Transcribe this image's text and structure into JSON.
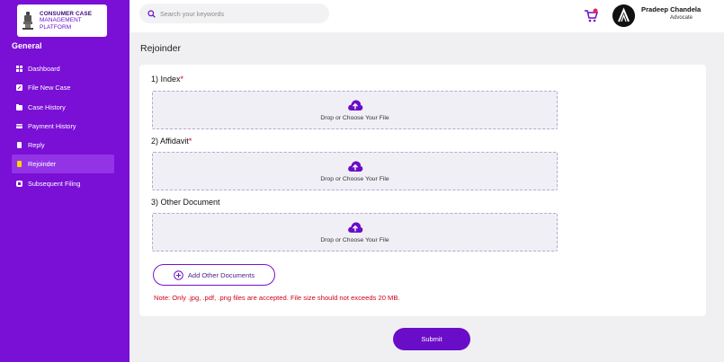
{
  "app": {
    "logo_line1": "CONSUMER CASE",
    "logo_line2": "MANAGEMENT",
    "logo_line3": "PLATFORM"
  },
  "sidebar": {
    "section": "General",
    "items": [
      {
        "label": "Dashboard",
        "icon": "grid-icon",
        "active": false
      },
      {
        "label": "File New Case",
        "icon": "edit-icon",
        "active": false
      },
      {
        "label": "Case History",
        "icon": "folder-icon",
        "active": false
      },
      {
        "label": "Payment History",
        "icon": "card-icon",
        "active": false
      },
      {
        "label": "Reply",
        "icon": "document-icon",
        "active": false
      },
      {
        "label": "Rejoinder",
        "icon": "document-icon",
        "active": true
      },
      {
        "label": "Subsequent Filing",
        "icon": "stack-icon",
        "active": false
      }
    ]
  },
  "header": {
    "search_placeholder": "Search your keywords",
    "user_name": "Pradeep Chandela",
    "user_role": "Advocate"
  },
  "page": {
    "title": "Rejoinder"
  },
  "fields": [
    {
      "label": "1) Index",
      "required": "*",
      "drop_text": "Drop or Choose Your File"
    },
    {
      "label": "2) Affidavit",
      "required": "*",
      "drop_text": "Drop or Choose Your File"
    },
    {
      "label": "3) Other Document",
      "required": "",
      "drop_text": "Drop or Choose Your File"
    }
  ],
  "actions": {
    "add_other": "Add Other Documents",
    "note": "Note: Only .jpg, .pdf, .png files are accepted. File size should not exceeds 20 MB.",
    "submit": "Submit"
  },
  "colors": {
    "brand": "#7a0fd6",
    "active_item": "#9234e6",
    "error": "#d0021b"
  }
}
